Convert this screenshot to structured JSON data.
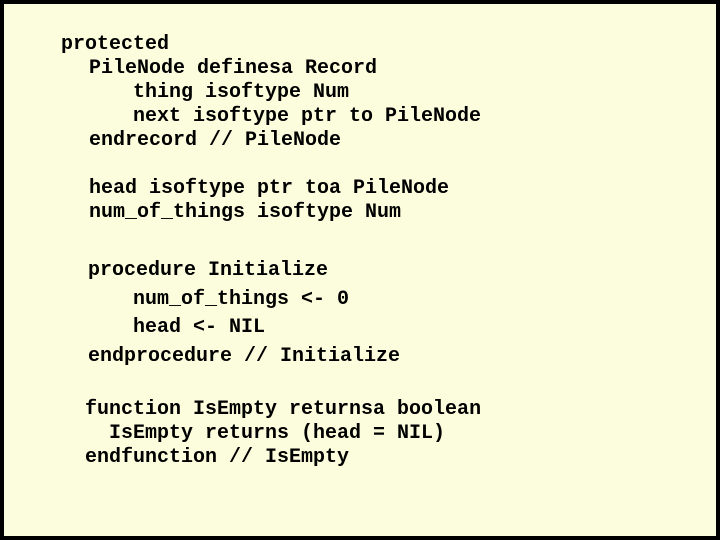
{
  "slide": {
    "background_color": "#FBFDDC",
    "border_color": "#000000",
    "code_lines": [
      "protected",
      "PileNode definesa Record",
      "thing isoftype Num",
      "next isoftype ptr to PileNode",
      "endrecord // PileNode",
      "head isoftype ptr toa PileNode",
      "num_of_things isoftype Num",
      "procedure Initialize",
      "num_of_things <- 0",
      "head <- NIL",
      "endprocedure // Initialize",
      "function IsEmpty returnsa boolean",
      "IsEmpty returns (head = NIL)",
      "endfunction // IsEmpty"
    ]
  }
}
